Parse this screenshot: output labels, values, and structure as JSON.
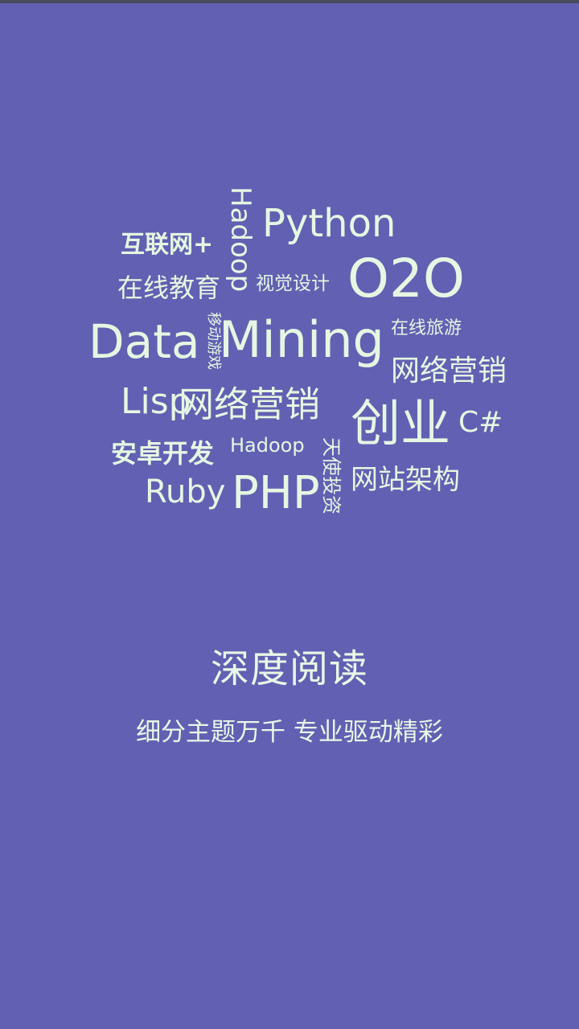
{
  "splash": {
    "word_cloud": [
      {
        "id": "hulianwang",
        "text": "互联网+"
      },
      {
        "id": "hadoop-vertical",
        "text": "Hadoop"
      },
      {
        "id": "python",
        "text": "Python"
      },
      {
        "id": "zaixian-jiaoyu",
        "text": "在线教育"
      },
      {
        "id": "shijue-sheji",
        "text": "视觉设计"
      },
      {
        "id": "o2o",
        "text": "O2O"
      },
      {
        "id": "yidong-youxi",
        "text": "移动游戏"
      },
      {
        "id": "data",
        "text": "Data"
      },
      {
        "id": "mining",
        "text": "Mining"
      },
      {
        "id": "zaixian-lvyou",
        "text": "在线旅游"
      },
      {
        "id": "wangluo-yingxiao-1",
        "text": "网络营销"
      },
      {
        "id": "lisp",
        "text": "Lisp"
      },
      {
        "id": "wangluo-yingxiao-2",
        "text": "网络营销"
      },
      {
        "id": "chuangye",
        "text": "创业"
      },
      {
        "id": "csharp",
        "text": "C#"
      },
      {
        "id": "anzhuo-kaifa",
        "text": "安卓开发"
      },
      {
        "id": "hadoop-small",
        "text": "Hadoop"
      },
      {
        "id": "tianshi-touzi",
        "text": "天使投资"
      },
      {
        "id": "wangzhan-jiagou",
        "text": "网站架构"
      },
      {
        "id": "ruby",
        "text": "Ruby"
      },
      {
        "id": "php",
        "text": "PHP"
      }
    ],
    "headline": "深度阅读",
    "subline": "细分主题万千 专业驱动精彩"
  },
  "colors": {
    "background": "#6160b2",
    "text": "#e8f5e4"
  }
}
